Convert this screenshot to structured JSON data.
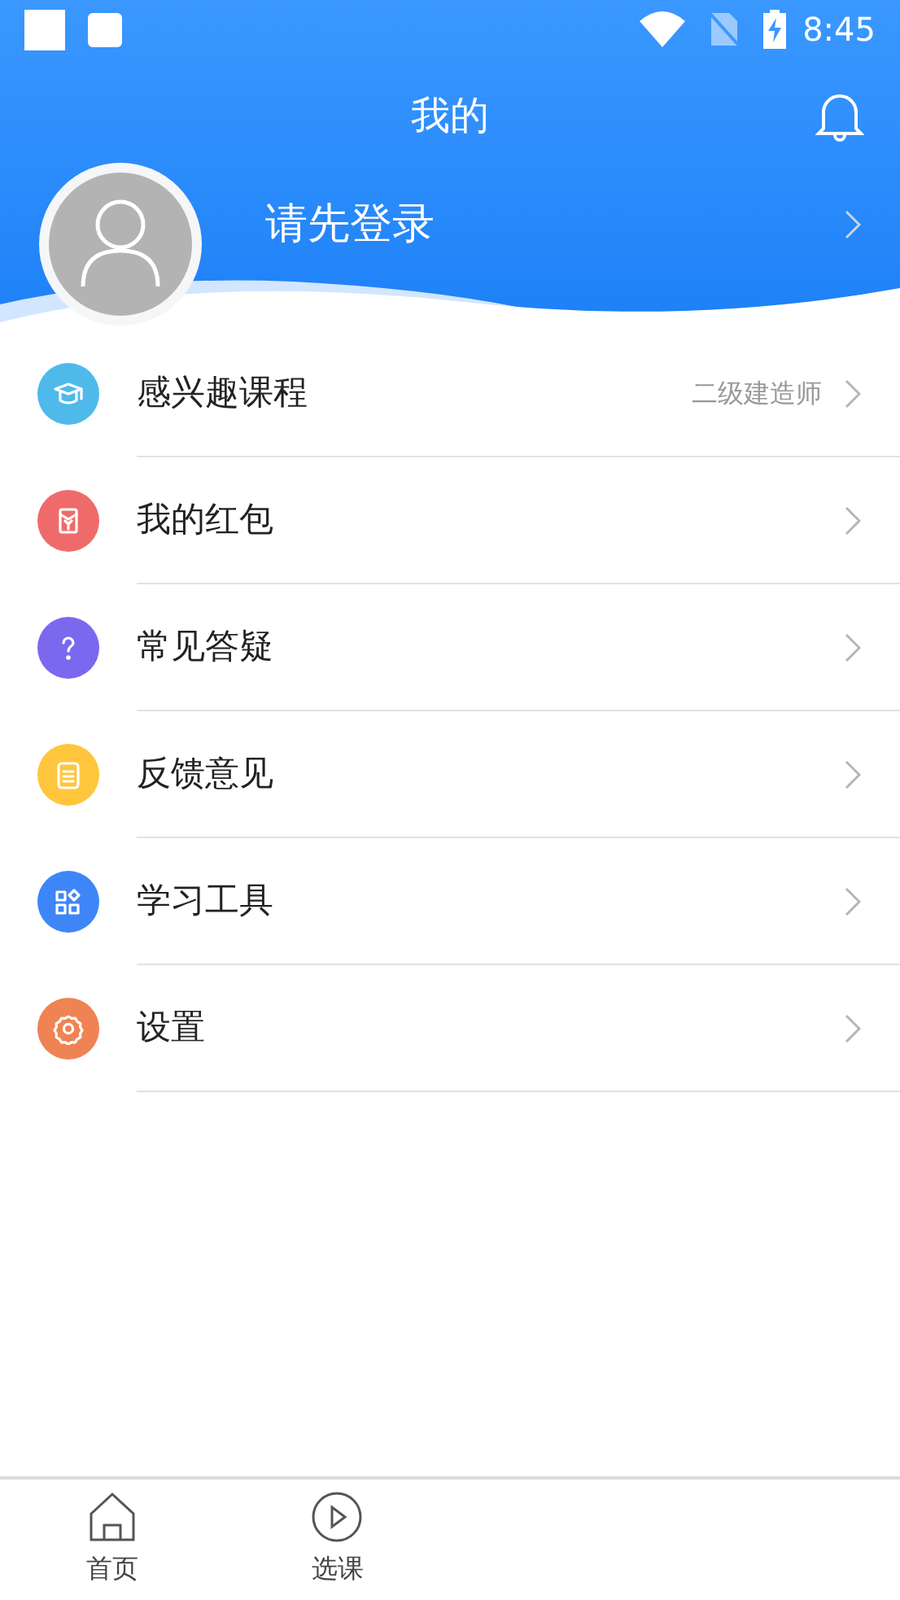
{
  "status_bar": {
    "time": "8:45"
  },
  "header": {
    "title": "我的",
    "login_prompt": "请先登录"
  },
  "menu": [
    {
      "label": "感兴趣课程",
      "value": "二级建造师",
      "color": "#4fb9ea",
      "kind": "course"
    },
    {
      "label": "我的红包",
      "color": "#ef6b6b",
      "kind": "redpacket"
    },
    {
      "label": "常见答疑",
      "color": "#7b68ee",
      "kind": "question"
    },
    {
      "label": "反馈意见",
      "color": "#ffc53d",
      "kind": "feedback"
    },
    {
      "label": "学习工具",
      "color": "#3e86f7",
      "kind": "tools"
    },
    {
      "label": "设置",
      "color": "#ef8354",
      "kind": "settings"
    }
  ],
  "tab_bar": [
    {
      "label": "首页",
      "kind": "home",
      "selected": false
    },
    {
      "label": "选课",
      "kind": "play",
      "selected": false
    }
  ]
}
